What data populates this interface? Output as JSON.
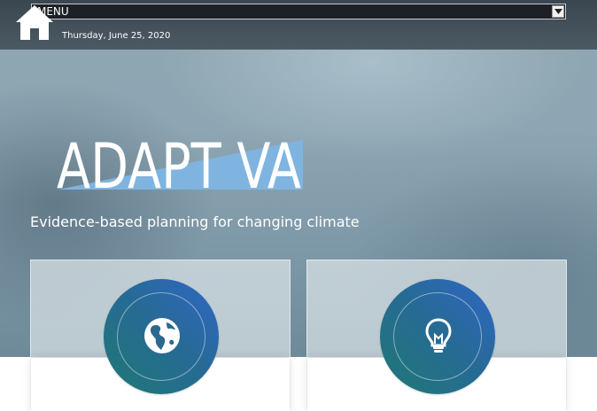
{
  "header": {
    "menu_label": "MENU",
    "date": "Thursday, June 25, 2020"
  },
  "hero": {
    "logo_text": "ADAPT VA",
    "tagline": "Evidence-based planning for changing climate"
  },
  "cards": [
    {
      "icon": "globe-icon"
    },
    {
      "icon": "lightbulb-icon"
    }
  ],
  "colors": {
    "badge_start": "#1f7874",
    "badge_end": "#3067c7",
    "logo_accent": "#7fb4e0"
  }
}
